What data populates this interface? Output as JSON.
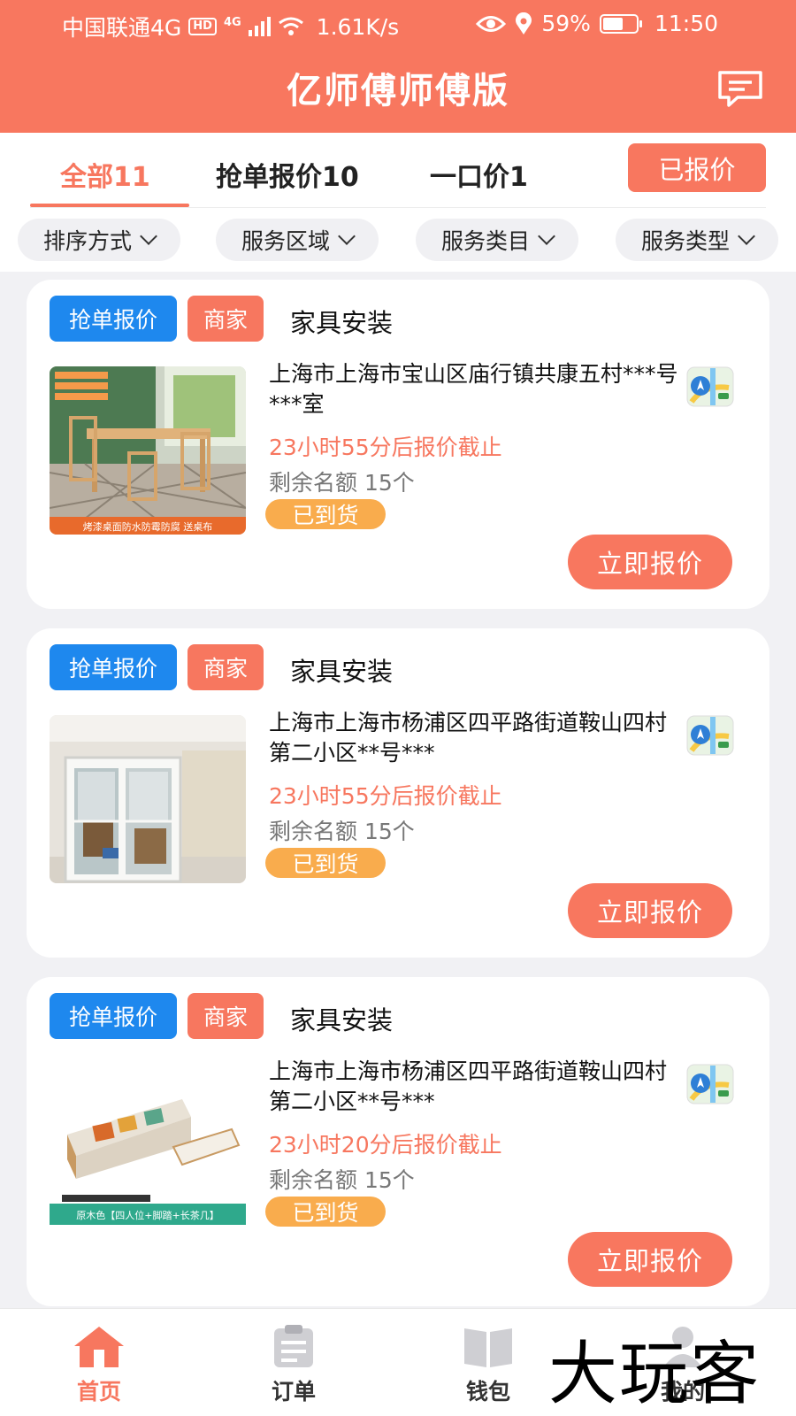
{
  "status_bar": {
    "carrier": "中国联通4G",
    "hd": "HD",
    "net_gen": "4G",
    "speed": "1.61K/s",
    "battery": "59%",
    "time": "11:50"
  },
  "header": {
    "title": "亿师傅师傅版"
  },
  "tabs": [
    {
      "label": "全部11",
      "active": true
    },
    {
      "label": "抢单报价10",
      "active": false
    },
    {
      "label": "一口价1",
      "active": false
    }
  ],
  "quoted_button": "已报价",
  "filters": [
    "排序方式",
    "服务区域",
    "服务类目",
    "服务类型"
  ],
  "orders": [
    {
      "tag_type": "抢单报价",
      "tag_source": "商家",
      "title": "家具安装",
      "address": "上海市上海市宝山区庙行镇共康五村***号***室",
      "deadline": "23小时55分后报价截止",
      "remaining": "剩余名额 15个",
      "badge": "已到货",
      "action": "立即报价",
      "image_caption": "烤漆桌面防水防霉防腐 送桌布"
    },
    {
      "tag_type": "抢单报价",
      "tag_source": "商家",
      "title": "家具安装",
      "address": "上海市上海市杨浦区四平路街道鞍山四村第二小区**号***",
      "deadline": "23小时55分后报价截止",
      "remaining": "剩余名额 15个",
      "badge": "已到货",
      "action": "立即报价",
      "image_caption": ""
    },
    {
      "tag_type": "抢单报价",
      "tag_source": "商家",
      "title": "家具安装",
      "address": "上海市上海市杨浦区四平路街道鞍山四村第二小区**号***",
      "deadline": "23小时20分后报价截止",
      "remaining": "剩余名额 15个",
      "badge": "已到货",
      "action": "立即报价",
      "image_caption": "原木色【四人位+脚踏+长茶几】"
    }
  ],
  "bottom_nav": [
    {
      "label": "首页",
      "icon": "home-icon",
      "active": true
    },
    {
      "label": "订单",
      "icon": "clipboard-icon",
      "active": false
    },
    {
      "label": "钱包",
      "icon": "book-icon",
      "active": false
    },
    {
      "label": "我的",
      "icon": "profile-icon",
      "active": false
    }
  ],
  "watermark": "大玩客",
  "colors": {
    "accent": "#f8775f",
    "blue": "#1e88ee",
    "badge": "#f9ac4d"
  }
}
